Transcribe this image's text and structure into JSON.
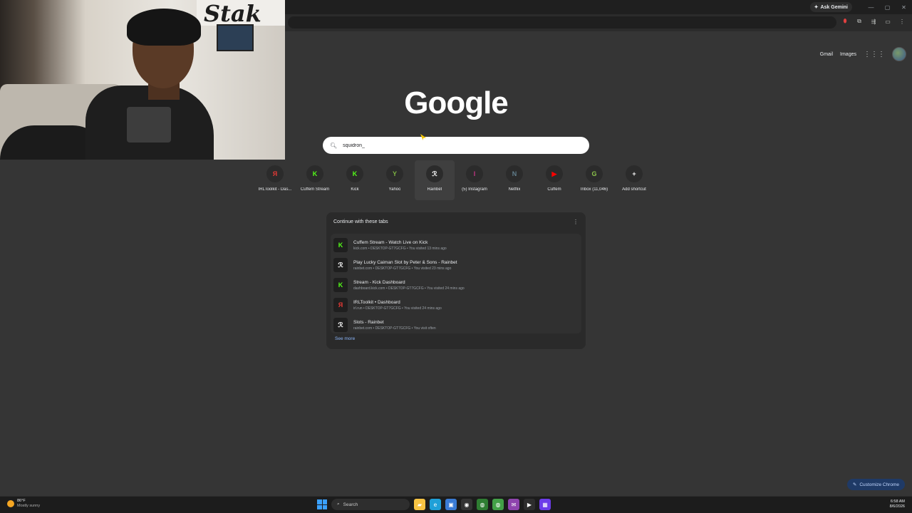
{
  "window": {
    "ask_gemini_label": "Ask Gemini",
    "controls": [
      "—",
      "▢",
      "✕"
    ]
  },
  "toolbar": {
    "icons": [
      "shield-extension-icon",
      "extensions-icon",
      "tab-search-icon",
      "cast-icon",
      "menu-icon"
    ]
  },
  "header": {
    "gmail_label": "Gmail",
    "images_label": "Images"
  },
  "logo_text": "Google",
  "search": {
    "value": "squidron_"
  },
  "shortcuts": [
    {
      "label": "IRLToolkit - Das...",
      "glyph": "Я",
      "color": "#e53935"
    },
    {
      "label": "Cuffem Stream",
      "glyph": "K",
      "color": "#53fc18"
    },
    {
      "label": "Kick",
      "glyph": "K",
      "color": "#53fc18"
    },
    {
      "label": "Yahoo",
      "glyph": "Y",
      "color": "#7cb342"
    },
    {
      "label": "Rainbet",
      "glyph": "ℛ",
      "color": "#ffffff"
    },
    {
      "label": "(5) Instagram",
      "glyph": "I",
      "color": "#c13584"
    },
    {
      "label": "Netflix",
      "glyph": "N",
      "color": "#607d8b"
    },
    {
      "label": "Cuffem",
      "glyph": "▶",
      "color": "#ff0000"
    },
    {
      "label": "Inbox (11,046)",
      "glyph": "G",
      "color": "#8bc34a"
    },
    {
      "label": "Add shortcut",
      "glyph": "+",
      "color": "#ffffff"
    }
  ],
  "continue_card": {
    "title": "Continue with these tabs",
    "see_more": "See more",
    "tabs": [
      {
        "title": "Cuffem Stream - Watch Live on Kick",
        "meta": "kick.com • DESKTOP-GT7GCFG • You visited 13 mins ago",
        "glyph": "K",
        "color": "#53fc18"
      },
      {
        "title": "Play Lucky Caiman Slot by Peter & Sons - Rainbet",
        "meta": "rainbet.com • DESKTOP-GT7GCFG • You visited 23 mins ago",
        "glyph": "ℛ",
        "color": "#ffffff"
      },
      {
        "title": "Stream - Kick Dashboard",
        "meta": "dashboard.kick.com • DESKTOP-GT7GCFG • You visited 24 mins ago",
        "glyph": "K",
        "color": "#53fc18"
      },
      {
        "title": "IRLToolkit • Dashboard",
        "meta": "irl.run • DESKTOP-GT7GCFG • You visited 24 mins ago",
        "glyph": "Я",
        "color": "#e53935"
      },
      {
        "title": "Slots - Rainbet",
        "meta": "rainbet.com • DESKTOP-GT7GCFG • You visit often",
        "glyph": "ℛ",
        "color": "#ffffff"
      }
    ]
  },
  "customize_label": "Customize Chrome",
  "webcam": {
    "sign_text": "Stak"
  },
  "taskbar": {
    "weather_temp": "86°F",
    "weather_desc": "Mostly sunny",
    "search_label": "Search",
    "time": "6:58 AM",
    "date": "8/6/2026",
    "apps": [
      {
        "name": "file-explorer-icon",
        "glyph": "▰",
        "color": "#f6c343"
      },
      {
        "name": "edge-icon",
        "glyph": "e",
        "color": "#1fa0d8"
      },
      {
        "name": "store-icon",
        "glyph": "▣",
        "color": "#3a7bd5"
      },
      {
        "name": "obs-icon",
        "glyph": "◉",
        "color": "#333333"
      },
      {
        "name": "chrome-icon",
        "glyph": "◍",
        "color": "#2e7d32"
      },
      {
        "name": "chrome-alt-icon",
        "glyph": "◍",
        "color": "#43a047"
      },
      {
        "name": "messenger-icon",
        "glyph": "✉",
        "color": "#8e44ad"
      },
      {
        "name": "media-player-icon",
        "glyph": "▶",
        "color": "#2d2d2d"
      },
      {
        "name": "grid-app-icon",
        "glyph": "▦",
        "color": "#6c3ce9"
      }
    ]
  }
}
